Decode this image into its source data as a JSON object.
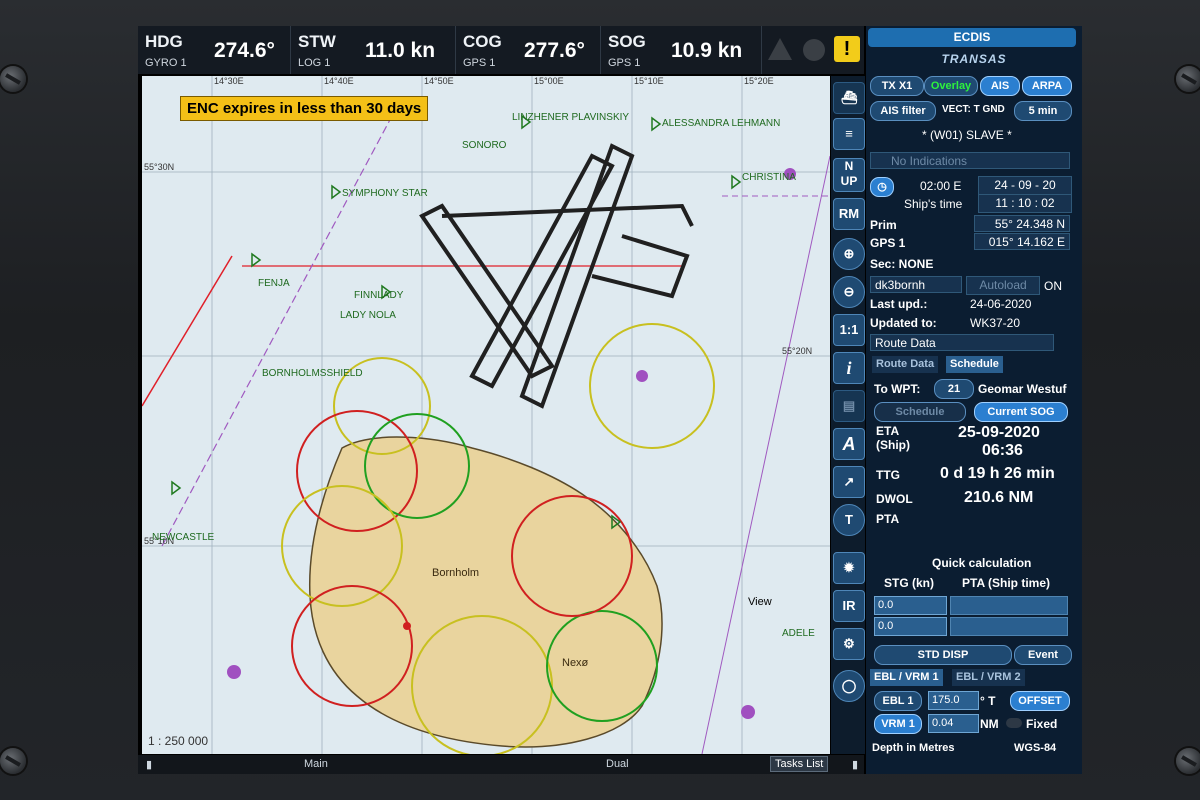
{
  "topbar": {
    "hdg": {
      "label": "HDG",
      "source": "GYRO 1",
      "value": "274.6°"
    },
    "stw": {
      "label": "STW",
      "source": "LOG 1",
      "value": "11.0 kn"
    },
    "cog": {
      "label": "COG",
      "source": "GPS 1",
      "value": "277.6°"
    },
    "sog": {
      "label": "SOG",
      "source": "GPS 1",
      "value": "10.9 kn"
    },
    "warning_icon": "exclamation-icon"
  },
  "chart": {
    "enc_warning": "ENC expires in less than 30 days",
    "scale": "1 : 250 000",
    "view_label": "View",
    "lat_labels": [
      "55°30N",
      "55°20N",
      "55°10N"
    ],
    "lon_labels": [
      "14°30E",
      "14°40E",
      "14°50E",
      "15°00E",
      "15°10E",
      "15°20E"
    ],
    "place_labels": [
      "SYMPHONY STAR",
      "FINNLADY",
      "LADY NOLA",
      "BORNHOLMSSHIELD",
      "NEWCASTLE",
      "Bornholm",
      "Nexø",
      "ALESSANDRA LEHMANN",
      "CHRISTINA",
      "LINZHENER PLAVINSKIY",
      "SONORO",
      "FENJA",
      "ADELE"
    ]
  },
  "toolbar": {
    "buttons": [
      "N UP",
      "RM",
      "1:1",
      "i",
      "IR"
    ]
  },
  "bottombar": {
    "main": "Main",
    "dual": "Dual",
    "tasks": "Tasks List"
  },
  "panel": {
    "header": "ECDIS",
    "brand": "TRANSAS",
    "tx": "TX X1",
    "overlay": "Overlay",
    "ais": "AIS",
    "arpa": "ARPA",
    "ais_filter": "AIS filter",
    "vect": "VECT: T GND",
    "vect_time": "5 min",
    "slave": "* (W01) SLAVE *",
    "indications": "No Indications",
    "time_zone": "02:00 E",
    "date": "24 - 09 - 20",
    "ships_time_label": "Ship's time",
    "ships_time": "11 : 10 : 02",
    "prim_label": "Prim",
    "lat": "55° 24.348 N",
    "gps_label": "GPS 1",
    "lon": "015° 14.162 E",
    "sec": "Sec: NONE",
    "chart_folder": "dk3bornh",
    "autoload": "Autoload",
    "autoload_state": "ON",
    "last_upd_label": "Last upd.:",
    "last_upd": "24-06-2020",
    "updated_to_label": "Updated to:",
    "updated_to": "WK37-20",
    "route_data_select": "Route Data",
    "tab_route": "Route Data",
    "tab_schedule": "Schedule",
    "to_wpt_label": "To WPT:",
    "wpt_num": "21",
    "wpt_name": "Geomar Westuf",
    "schedule_btn": "Schedule",
    "current_sog_btn": "Current SOG",
    "eta_label": "ETA",
    "eta_sub": "(Ship)",
    "eta_date": "25-09-2020",
    "eta_time": "06:36",
    "ttg_label": "TTG",
    "ttg": "0 d 19 h 26 min",
    "dwol_label": "DWOL",
    "dwol": "210.6 NM",
    "pta_label": "PTA",
    "quick_calc": "Quick calculation",
    "stg_header": "STG (kn)",
    "pta_header": "PTA (Ship time)",
    "stg1": "0.0",
    "stg2": "0.0",
    "std_disp": "STD DISP",
    "event": "Event",
    "ebl_tab1": "EBL / VRM 1",
    "ebl_tab2": "EBL / VRM 2",
    "ebl_btn": "EBL 1",
    "ebl_val": "175.0",
    "ebl_unit": "° T",
    "offset": "OFFSET",
    "vrm_btn": "VRM 1",
    "vrm_val": "0.04",
    "vrm_unit": "NM",
    "fixed": "Fixed",
    "depth": "Depth in Metres",
    "datum": "WGS-84"
  }
}
